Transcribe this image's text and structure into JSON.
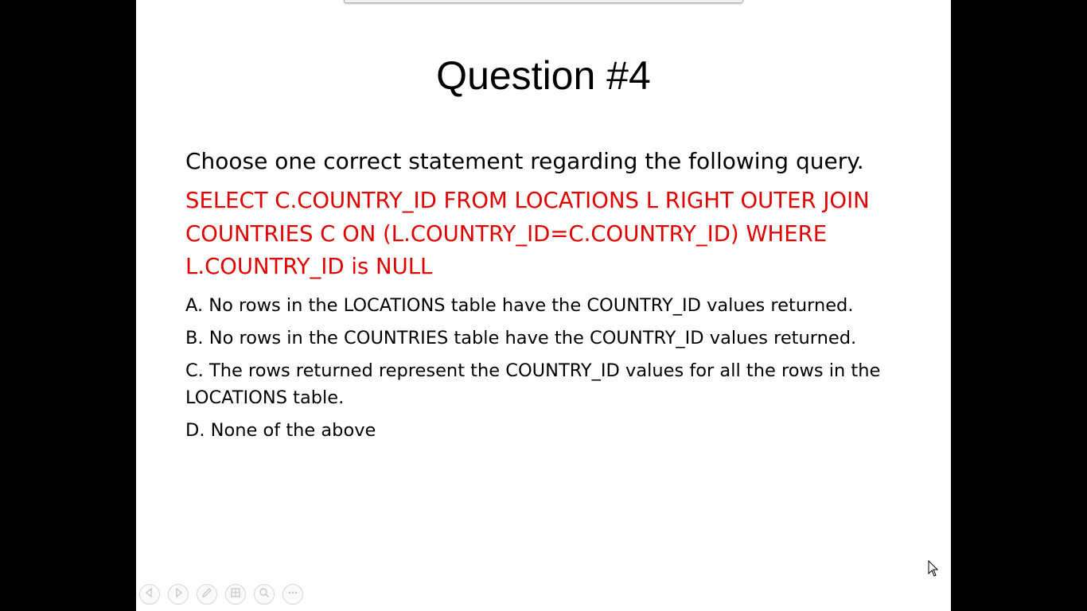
{
  "slide": {
    "title": "Question #4",
    "intro": "Choose one correct statement regarding the following query.",
    "query": "SELECT C.COUNTRY_ID FROM LOCATIONS L RIGHT OUTER JOIN COUNTRIES C ON (L.COUNTRY_ID=C.COUNTRY_ID) WHERE L.COUNTRY_ID is NULL",
    "options": [
      "A. No rows in the LOCATIONS table have the COUNTRY_ID values returned.",
      "B. No rows in the COUNTRIES table have the COUNTRY_ID values returned.",
      "C. The rows returned represent the COUNTRY_ID values for all the rows in the LOCATIONS table.",
      "D. None of the above"
    ]
  },
  "controls": {
    "icons": [
      "previous-icon",
      "next-icon",
      "pen-icon",
      "slides-icon",
      "zoom-icon",
      "more-icon"
    ]
  },
  "colors": {
    "query_text": "#e00000",
    "slide_background": "#ffffff",
    "screen_background": "#000000"
  }
}
